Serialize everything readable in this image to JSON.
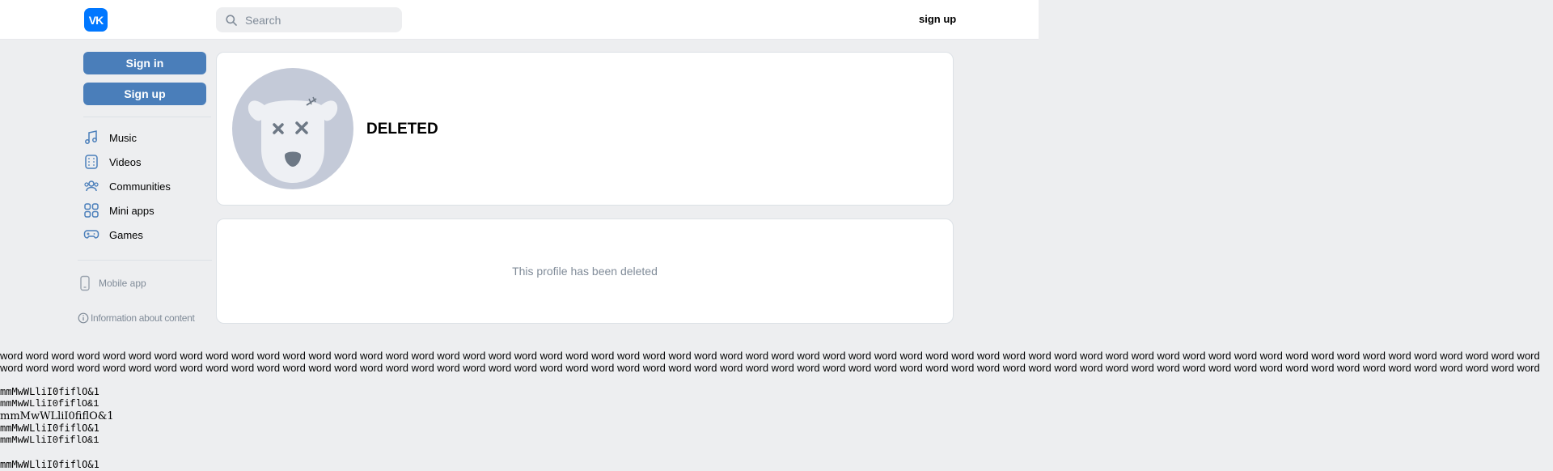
{
  "header": {
    "logo_text": "VK",
    "search_placeholder": "Search",
    "signup_label": "sign up"
  },
  "sidebar": {
    "signin_label": "Sign in",
    "signup_label": "Sign up",
    "nav": [
      {
        "label": "Music",
        "icon": "music-icon"
      },
      {
        "label": "Videos",
        "icon": "video-icon"
      },
      {
        "label": "Communities",
        "icon": "communities-icon"
      },
      {
        "label": "Mini apps",
        "icon": "mini-apps-icon"
      },
      {
        "label": "Games",
        "icon": "gamepad-icon"
      }
    ],
    "mobile_app_label": "Mobile app",
    "info_label": "Information about content"
  },
  "profile": {
    "name": "DELETED",
    "deleted_message": "This profile has been deleted"
  },
  "filler_word": "word",
  "filler_count": 120,
  "font_samples": [
    "mmMwWLliI0fiflO&1",
    "mmMwWLliI0fiflO&1",
    "mmMwWLliI0fiflO&1",
    "mmMwWLliI0fiflO&1",
    "mmMwWLliI0fiflO&1",
    "mmMwWLliI0fiflO&1"
  ],
  "colors": {
    "accent": "#4a7eba",
    "logo": "#0077ff",
    "background": "#edeef0",
    "muted_text": "#818c99"
  }
}
